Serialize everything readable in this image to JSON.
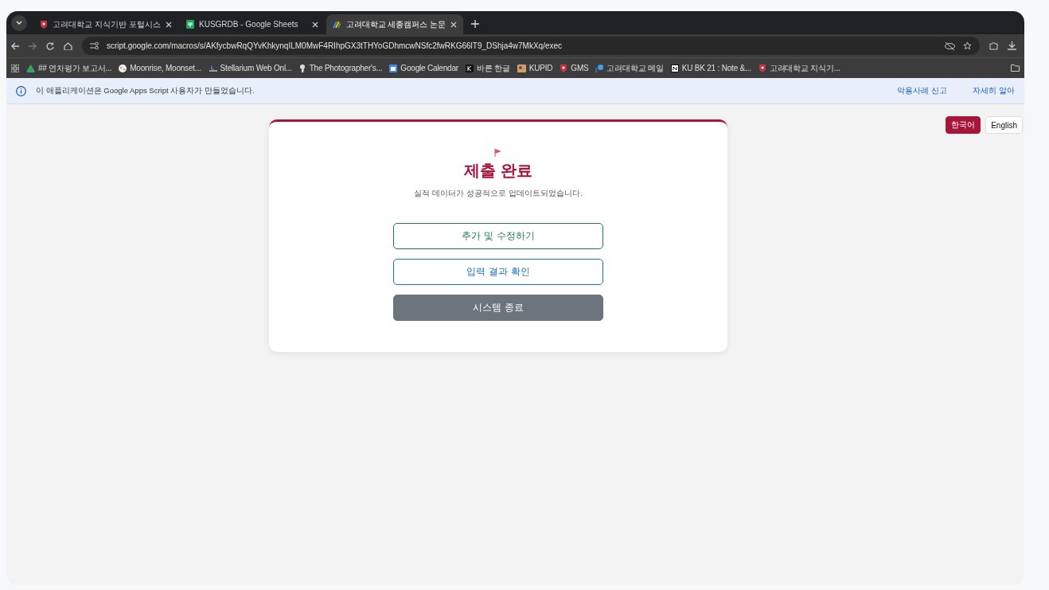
{
  "tabs": [
    {
      "title": "고려대학교 지식기반 포털시스",
      "selected": false
    },
    {
      "title": "KUSGRDB - Google Sheets",
      "selected": false
    },
    {
      "title": "고려대학교 세종캠퍼스 논문",
      "selected": true
    }
  ],
  "address_bar": {
    "url": "script.google.com/macros/s/AKfycbwRqQYvKhkynqILM0MwF4RIhpGX3tTHYoGDhmcwNSfc2fwRKG66lT9_DShja4w7MkXq/exec"
  },
  "bookmarks": [
    "## 연차평가 보고서...",
    "Moonrise, Moonset...",
    "Stellarium Web Onl...",
    "The Photographer's...",
    "Google Calendar",
    "바른 한글",
    "KUPID",
    "GMS",
    "고려대학교 메일",
    "KU BK 21 : Note &...",
    "고려대학교 지식기..."
  ],
  "info_bar": {
    "message": "이 애플리케이션은 Google Apps Script 사용자가 만들었습니다.",
    "links": [
      "악용사례 신고",
      "자세히 알아"
    ]
  },
  "languages": [
    {
      "label": "한국어",
      "selected": true
    },
    {
      "label": "English",
      "selected": false
    }
  ],
  "card": {
    "title": "제출 완료",
    "subtitle": "실적 데이터가 성공적으로 업데이트되었습니다.",
    "buttons": [
      {
        "label": "추가 및 수정하기",
        "kind": "green"
      },
      {
        "label": "입력 결과 확인",
        "kind": "blue"
      },
      {
        "label": "시스템 종료",
        "kind": "gray"
      }
    ]
  }
}
